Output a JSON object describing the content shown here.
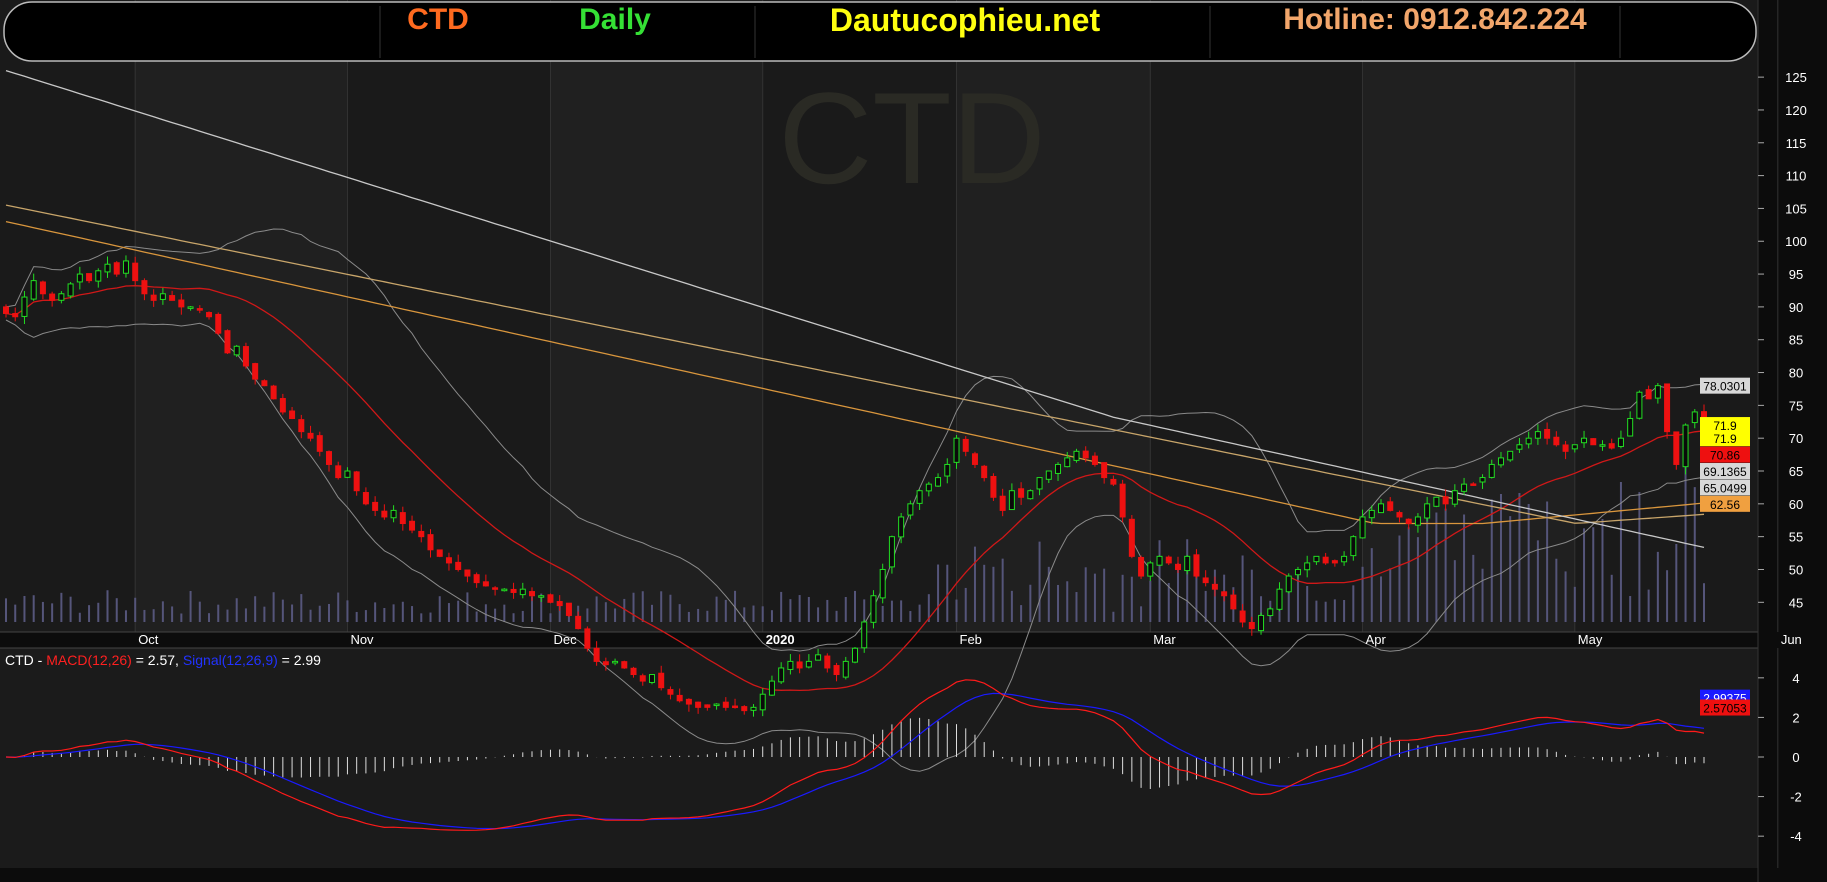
{
  "header": {
    "ticker": "CTD",
    "interval": "Daily",
    "site": "Dautucophieu.net",
    "hotline": "Hotline: 0912.842.224"
  },
  "colors": {
    "up": "#22dd22",
    "down": "#ee1111",
    "volume": "#55557a",
    "ma_red": "#d01818",
    "ma_orange1": "#d9963d",
    "ma_orange2": "#c8a56a",
    "ma_white": "#c8c8c8",
    "band": "#8a8a8a",
    "macd": "#ff1a1a",
    "signal": "#1a1aff"
  },
  "chart_data": [
    {
      "type": "candlestick",
      "watermark": "CTD",
      "y_ticks": [
        125,
        120,
        115,
        110,
        105,
        100,
        95,
        90,
        85,
        80,
        75,
        70,
        65,
        60,
        55,
        50,
        45
      ],
      "ylim": [
        42,
        127
      ],
      "months": [
        {
          "label": "Oct",
          "i": 14
        },
        {
          "label": "Nov",
          "i": 37
        },
        {
          "label": "Dec",
          "i": 59
        },
        {
          "label": "2020",
          "i": 82
        },
        {
          "label": "Feb",
          "i": 103
        },
        {
          "label": "Mar",
          "i": 124
        },
        {
          "label": "Apr",
          "i": 147
        },
        {
          "label": "May",
          "i": 170
        },
        {
          "label": "Jun",
          "i": 192
        }
      ],
      "closes": [
        89,
        88.5,
        91.5,
        94,
        92,
        91,
        92,
        93.5,
        95,
        94,
        95.5,
        96.5,
        95,
        97,
        94,
        92,
        91,
        92,
        91,
        90,
        90,
        89.5,
        88.5,
        86,
        83,
        84,
        81,
        79,
        78,
        76,
        74,
        73,
        71,
        70,
        68,
        66,
        64,
        65,
        62,
        60,
        59,
        58,
        59,
        57,
        56,
        55,
        53,
        52,
        51,
        50,
        49,
        48,
        47.5,
        47,
        47,
        46.5,
        47,
        46,
        46,
        45,
        44.5,
        43,
        41,
        38,
        36,
        35.5,
        36,
        35,
        34,
        33,
        34,
        32,
        31,
        30,
        29.5,
        29,
        29,
        29.5,
        29,
        29,
        28.5,
        29,
        31,
        33,
        35,
        36,
        35,
        36,
        37,
        35,
        34,
        36,
        38,
        42,
        46,
        50,
        55,
        58,
        60,
        62,
        63,
        64,
        66,
        70,
        68,
        66,
        64,
        61,
        59,
        62,
        61,
        62,
        64,
        65,
        66,
        67,
        68,
        67,
        66,
        64,
        63,
        58,
        52,
        49,
        51,
        52,
        51,
        50,
        52,
        49,
        48,
        47,
        46,
        44,
        42,
        41,
        43,
        44,
        47,
        49,
        50,
        51,
        52,
        51,
        51,
        52,
        55,
        58,
        59,
        60,
        59,
        58,
        57,
        58,
        60,
        61,
        60,
        62,
        63,
        63,
        64,
        66,
        67,
        68,
        69,
        70,
        71,
        70,
        69,
        68,
        69,
        70,
        69,
        69,
        68.5,
        70,
        73,
        77,
        76,
        78,
        71,
        66,
        72,
        74,
        71.9
      ]
    },
    {
      "type": "macd",
      "legend": {
        "ticker": "CTD",
        "sep1": " - ",
        "macd_name": "MACD(12,26)",
        "macd_val": " = 2.57, ",
        "signal_name": "Signal(12,26,9)",
        "signal_val": " = 2.99"
      },
      "y_ticks": [
        4,
        2,
        0,
        -2,
        -4
      ],
      "ylim": [
        -4.8,
        4.8
      ],
      "macd_last": 2.57,
      "signal_last": 2.99
    }
  ],
  "price_tags": [
    {
      "text": "78.0301",
      "bg": "#d8d8d8",
      "fg": "#000",
      "value": 78.0
    },
    {
      "text": "71.9",
      "bg": "#ffff00",
      "fg": "#000",
      "value": 72.0
    },
    {
      "text": "71.9",
      "bg": "#ffff00",
      "fg": "#000",
      "value": 70.0
    },
    {
      "text": "70.86",
      "bg": "#ee1010",
      "fg": "#000",
      "value": 67.5
    },
    {
      "text": "69.1365",
      "bg": "#d8d8d8",
      "fg": "#000",
      "value": 65.0
    },
    {
      "text": "65.0499",
      "bg": "#d8d8d8",
      "fg": "#000",
      "value": 62.5
    },
    {
      "text": "62.56",
      "bg": "#f0a040",
      "fg": "#000",
      "value": 60.0
    }
  ],
  "macd_tags": [
    {
      "text": "2.99375",
      "bg": "#1a1aff",
      "fg": "#fff",
      "value": 3.0
    },
    {
      "text": "2.57053",
      "bg": "#ee1010",
      "fg": "#000",
      "value": 2.5
    }
  ]
}
